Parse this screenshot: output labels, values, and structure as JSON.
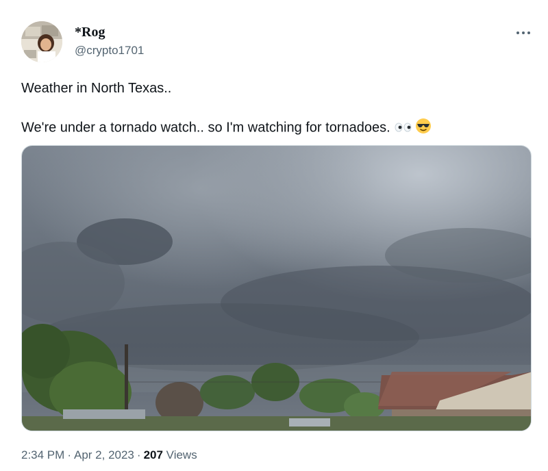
{
  "author": {
    "display_name": "*Rog",
    "handle": "@crypto1701",
    "avatar_icon": "profile-photo"
  },
  "tweet": {
    "line1": "Weather in North Texas..",
    "line2": "We're under a tornado watch.. so I'm watching for tornadoes.",
    "emojis": [
      "eyes-emoji",
      "sunglasses-smiley-emoji"
    ]
  },
  "media": {
    "icon": "photo-stormy-sky"
  },
  "meta": {
    "time": "2:34 PM",
    "date": "Apr 2, 2023",
    "views_count": "207",
    "views_label": "Views",
    "separator": "·"
  },
  "colors": {
    "text_primary": "#0f1419",
    "text_secondary": "#536471",
    "border": "#cfd9de"
  }
}
